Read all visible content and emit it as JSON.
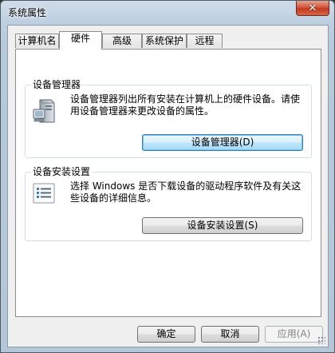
{
  "window": {
    "title": "系统属性",
    "close_glyph": "✕"
  },
  "tabs": [
    {
      "label": "计算机名"
    },
    {
      "label": "硬件"
    },
    {
      "label": "高级"
    },
    {
      "label": "系统保护"
    },
    {
      "label": "远程"
    }
  ],
  "active_tab": "硬件",
  "device_manager": {
    "title": "设备管理器",
    "description": "设备管理器列出所有安装在计算机上的硬件设备。请使用设备管理器来更改设备的属性。",
    "button_label": "设备管理器(D)"
  },
  "device_install": {
    "title": "设备安装设置",
    "description": "选择 Windows 是否下载设备的驱动程序软件及有关这些设备的详细信息。",
    "button_label": "设备安装设置(S)"
  },
  "footer": {
    "ok_label": "确定",
    "cancel_label": "取消",
    "apply_label": "应用(A)"
  },
  "colors": {
    "titlebar": "#c7d8e7",
    "close_button": "#c9452a",
    "focus_button": "#bee6fd"
  },
  "icons": {
    "device_manager": "computer-tower-icon",
    "device_install": "checklist-icon"
  }
}
